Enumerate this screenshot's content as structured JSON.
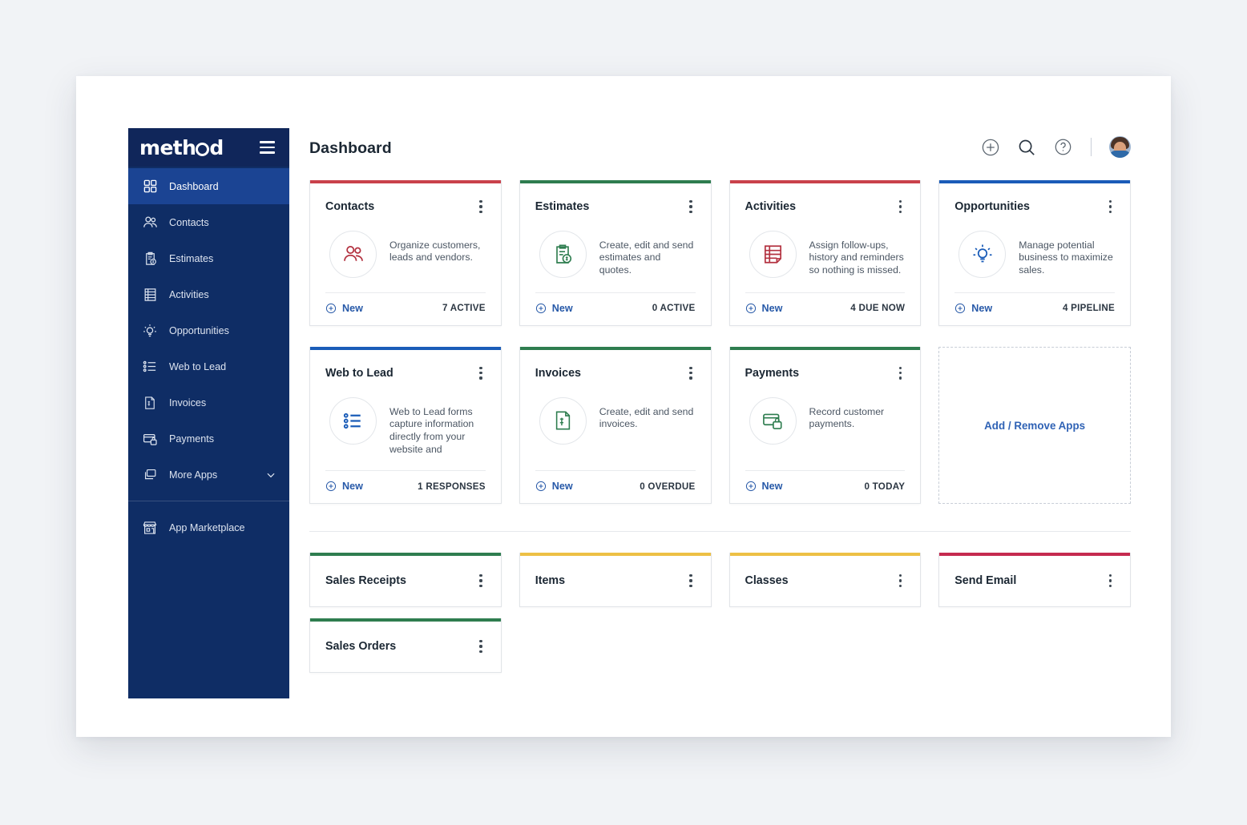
{
  "brand": {
    "name": "method",
    "logo_text_pre": "meth",
    "logo_text_post": "d"
  },
  "header": {
    "title": "Dashboard",
    "icons": [
      "plus-circle-icon",
      "search-icon",
      "help-circle-icon"
    ],
    "avatar": "user-avatar"
  },
  "sidebar": {
    "items": [
      {
        "label": "Dashboard",
        "icon": "grid-icon",
        "active": true
      },
      {
        "label": "Contacts",
        "icon": "people-icon",
        "active": false
      },
      {
        "label": "Estimates",
        "icon": "clipboard-dollar-icon",
        "active": false
      },
      {
        "label": "Activities",
        "icon": "list-document-icon",
        "active": false
      },
      {
        "label": "Opportunities",
        "icon": "lightbulb-icon",
        "active": false
      },
      {
        "label": "Web to Lead",
        "icon": "bullet-list-icon",
        "active": false
      },
      {
        "label": "Invoices",
        "icon": "invoice-icon",
        "active": false
      },
      {
        "label": "Payments",
        "icon": "card-lock-icon",
        "active": false
      },
      {
        "label": "More Apps",
        "icon": "stack-icon",
        "active": false,
        "chevron": true
      }
    ],
    "footer": {
      "label": "App Marketplace",
      "icon": "storefront-icon"
    }
  },
  "cards": [
    {
      "title": "Contacts",
      "accent": "#c9414b",
      "icon": "people-icon",
      "icon_color": "#b33240",
      "description": "Organize customers, leads and vendors.",
      "new_label": "New",
      "count": "7 ACTIVE"
    },
    {
      "title": "Estimates",
      "accent": "#2e7d4f",
      "icon": "clipboard-dollar-icon",
      "icon_color": "#2e7d4f",
      "description": "Create, edit and send estimates and quotes.",
      "new_label": "New",
      "count": "0 ACTIVE"
    },
    {
      "title": "Activities",
      "accent": "#c9414b",
      "icon": "list-document-icon",
      "icon_color": "#b33240",
      "description": "Assign follow-ups, history and reminders so nothing is missed.",
      "new_label": "New",
      "count": "4 DUE NOW"
    },
    {
      "title": "Opportunities",
      "accent": "#1a5cb8",
      "icon": "lightbulb-icon",
      "icon_color": "#1a5cb8",
      "description": "Manage potential business to maximize sales.",
      "new_label": "New",
      "count": "4 PIPELINE"
    },
    {
      "title": "Web to Lead",
      "accent": "#1a5cb8",
      "icon": "bullet-list-icon",
      "icon_color": "#1a5cb8",
      "description": "Web to Lead forms capture information directly from your website and",
      "new_label": "New",
      "count": "1 RESPONSES"
    },
    {
      "title": "Invoices",
      "accent": "#2e7d4f",
      "icon": "invoice-icon",
      "icon_color": "#2e7d4f",
      "description": "Create, edit and send invoices.",
      "new_label": "New",
      "count": "0 OVERDUE"
    },
    {
      "title": "Payments",
      "accent": "#2e7d4f",
      "icon": "card-lock-icon",
      "icon_color": "#2e7d4f",
      "description": "Record customer payments.",
      "new_label": "New",
      "count": "0 TODAY"
    }
  ],
  "add_remove": {
    "label": "Add / Remove Apps"
  },
  "mini_cards": [
    {
      "title": "Sales Receipts",
      "accent": "#2e7d4f"
    },
    {
      "title": "Items",
      "accent": "#edc045"
    },
    {
      "title": "Classes",
      "accent": "#edc045"
    },
    {
      "title": "Send Email",
      "accent": "#c52a4f"
    },
    {
      "title": "Sales Orders",
      "accent": "#2e7d4f"
    }
  ]
}
